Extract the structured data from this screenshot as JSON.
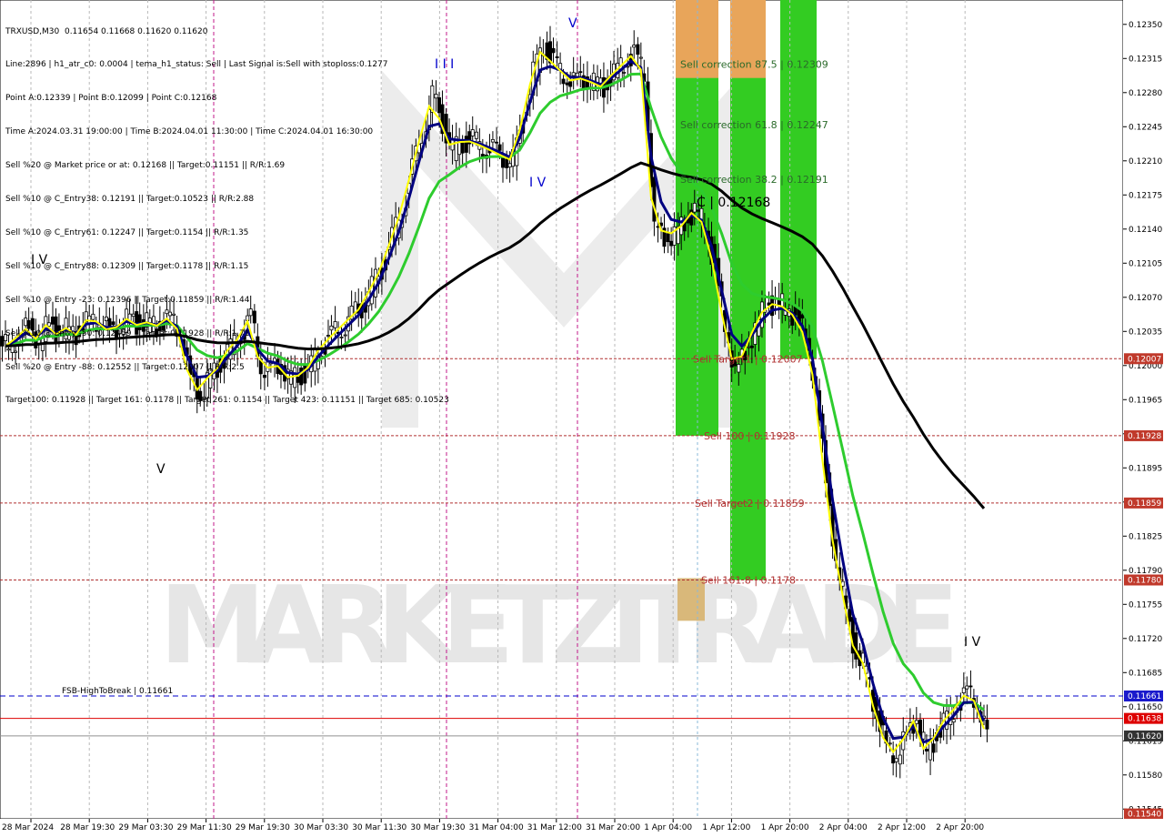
{
  "chart_data": {
    "type": "candlestick",
    "symbol": "TRXUSD,M30",
    "ohlc_header": "0.11654 0.11668 0.11620 0.11620",
    "info_lines": [
      "Line:2896 | h1_atr_c0: 0.0004 | tema_h1_status: Sell | Last Signal is:Sell with stoploss:0.1277",
      "Point A:0.12339 | Point B:0.12099 | Point C:0.12168",
      "Time A:2024.03.31 19:00:00 | Time B:2024.04.01 11:30:00 | Time C:2024.04.01 16:30:00",
      "Sell %20 @ Market price or at: 0.12168 || Target:0.11151 || R/R:1.69",
      "Sell %10 @ C_Entry38: 0.12191 || Target:0.10523 || R/R:2.88",
      "Sell %10 @ C_Entry61: 0.12247 || Target:0.1154 || R/R:1.35",
      "Sell %10 @ C_Entry88: 0.12309 || Target:0.1178 || R/R:1.15",
      "Sell %10 @ Entry -23: 0.12396 || Target:0.11859 || R/R:1.44",
      "Sell %10 @ Entry -50: 0.12459 || Target:0.11928 || R/R:1.71",
      "Sell %20 @ Entry -88: 0.12552 || Target:0.12007 || R/R:2.5",
      "Target100: 0.11928 || Target 161: 0.1178 || Target 261: 0.1154 || Target 423: 0.11151 || Target 685: 0.10523"
    ],
    "y_ticks": [
      "0.12350",
      "0.12315",
      "0.12280",
      "0.12245",
      "0.12210",
      "0.12175",
      "0.12140",
      "0.12105",
      "0.12070",
      "0.12035",
      "0.12000",
      "0.11965",
      "0.11930",
      "0.11895",
      "0.11860",
      "0.11825",
      "0.11790",
      "0.11755",
      "0.11720",
      "0.11685",
      "0.11650",
      "0.11615",
      "0.11580",
      "0.11545"
    ],
    "x_ticks": [
      "28 Mar 2024",
      "28 Mar 19:30",
      "29 Mar 03:30",
      "29 Mar 11:30",
      "29 Mar 19:30",
      "30 Mar 03:30",
      "30 Mar 11:30",
      "30 Mar 19:30",
      "31 Mar 04:00",
      "31 Mar 12:00",
      "31 Mar 20:00",
      "1 Apr 04:00",
      "1 Apr 12:00",
      "1 Apr 20:00",
      "2 Apr 04:00",
      "2 Apr 12:00",
      "2 Apr 20:00"
    ],
    "ylim": [
      0.11535,
      0.12375
    ],
    "levels": [
      {
        "label": "Sell correction 87.5 | 0.12309",
        "value": 0.12309
      },
      {
        "label": "Sell correction 61.8 | 0.12247",
        "value": 0.12247
      },
      {
        "label": "Sell correction 38.2 | 0.12191",
        "value": 0.12191
      },
      {
        "label": "Sell Target1 | 0.12007",
        "value": 0.12007,
        "badge": "0.12007"
      },
      {
        "label": "Sell 100 | 0.11928",
        "value": 0.11928,
        "badge": "0.11928"
      },
      {
        "label": "Sell Target2 | 0.11859",
        "value": 0.11859,
        "badge": "0.11859"
      },
      {
        "label": "Sell 161.8 | 0.1178",
        "value": 0.1178,
        "badge": "0.11780"
      }
    ],
    "fsb_label": "FSB-HighToBreak | 0.11661",
    "fsb_value": 0.11661,
    "fsb_badge": "0.11661",
    "red_line": 0.11638,
    "red_badge": "0.11638",
    "current_price": 0.1162,
    "current_badge": "0.11620",
    "bottom_badge": "0.11540",
    "bottom_value": 0.1154,
    "point_c_label": "C | 0.12168",
    "point_c_value": 0.12168,
    "wave_labels": [
      "I V",
      "V",
      "I I I",
      "V",
      "I V",
      "I V"
    ],
    "watermark": "MARKETZITRADE",
    "colors": {
      "ema_fast": "#ffff00",
      "ema_mid": "#000080",
      "ema_slow": "#2ecc2e",
      "sma_long": "#000000",
      "zone_green": "#33cc22",
      "zone_orange": "#e8a55a",
      "level_red": "#b03030",
      "fsb_blue": "#0000cc"
    },
    "series": [
      {
        "name": "close_path",
        "values": [
          0.1202,
          0.1203,
          0.1204,
          0.12025,
          0.12045,
          0.1203,
          0.1204,
          0.1203,
          0.1205,
          0.12045,
          0.12035,
          0.1204,
          0.1205,
          0.1204,
          0.12045,
          0.1204,
          0.1205,
          0.12035,
          0.11985,
          0.1197,
          0.1199,
          0.12,
          0.1202,
          0.1203,
          0.1205,
          0.12,
          0.11995,
          0.12,
          0.11985,
          0.1199,
          0.12,
          0.1202,
          0.1203,
          0.1204,
          0.1205,
          0.1206,
          0.1208,
          0.121,
          0.1213,
          0.1216,
          0.122,
          0.1224,
          0.12275,
          0.1225,
          0.1222,
          0.1223,
          0.1223,
          0.12225,
          0.1222,
          0.12215,
          0.1221,
          0.1225,
          0.123,
          0.1233,
          0.1231,
          0.123,
          0.1229,
          0.12295,
          0.1229,
          0.12285,
          0.123,
          0.1231,
          0.1232,
          0.123,
          0.1214,
          0.1213,
          0.12135,
          0.12145,
          0.1216,
          0.12145,
          0.121,
          0.1204,
          0.11995,
          0.1201,
          0.1204,
          0.1206,
          0.12065,
          0.1206,
          0.1205,
          0.1203,
          0.1198,
          0.1188,
          0.118,
          0.1175,
          0.117,
          0.1169,
          0.1164,
          0.1161,
          0.116,
          0.1162,
          0.1164,
          0.116,
          0.1162,
          0.1164,
          0.1165,
          0.11665,
          0.11655,
          0.1162
        ]
      }
    ]
  }
}
